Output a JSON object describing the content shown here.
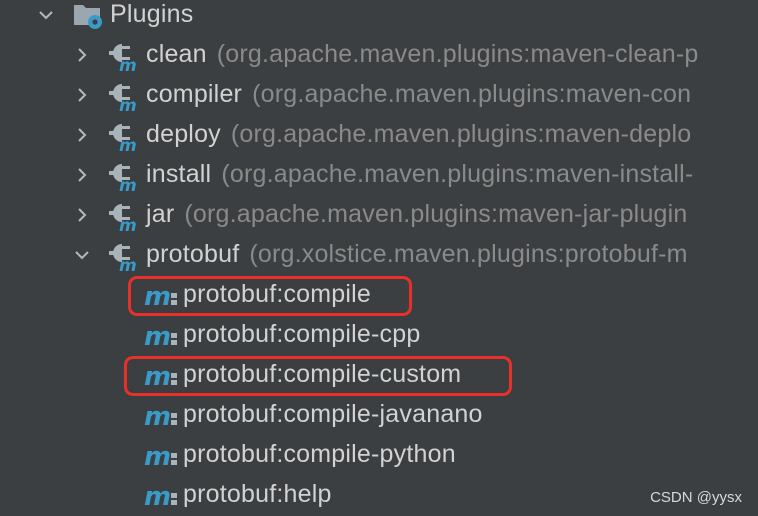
{
  "folder": {
    "label": "Plugins",
    "icon": "folder-gear-icon",
    "expanded": true
  },
  "plugins": [
    {
      "name": "clean",
      "coords": "(org.apache.maven.plugins:maven-clean-p",
      "expanded": false
    },
    {
      "name": "compiler",
      "coords": "(org.apache.maven.plugins:maven-con",
      "expanded": false
    },
    {
      "name": "deploy",
      "coords": "(org.apache.maven.plugins:maven-deplo",
      "expanded": false
    },
    {
      "name": "install",
      "coords": "(org.apache.maven.plugins:maven-install-",
      "expanded": false
    },
    {
      "name": "jar",
      "coords": "(org.apache.maven.plugins:maven-jar-plugin",
      "expanded": false
    },
    {
      "name": "protobuf",
      "coords": "(org.xolstice.maven.plugins:protobuf-m",
      "expanded": true
    }
  ],
  "goals": [
    {
      "label": "protobuf:compile",
      "highlighted": true
    },
    {
      "label": "protobuf:compile-cpp",
      "highlighted": false
    },
    {
      "label": "protobuf:compile-custom",
      "highlighted": true
    },
    {
      "label": "protobuf:compile-javanano",
      "highlighted": false
    },
    {
      "label": "protobuf:compile-python",
      "highlighted": false
    },
    {
      "label": "protobuf:help",
      "highlighted": false
    }
  ],
  "watermark": "CSDN @yysx",
  "colors": {
    "background": "#3c3f41",
    "text": "#d2d2d2",
    "muted": "#8a8a8a",
    "maven_blue": "#3a9bc9",
    "highlight": "#e8302d"
  }
}
